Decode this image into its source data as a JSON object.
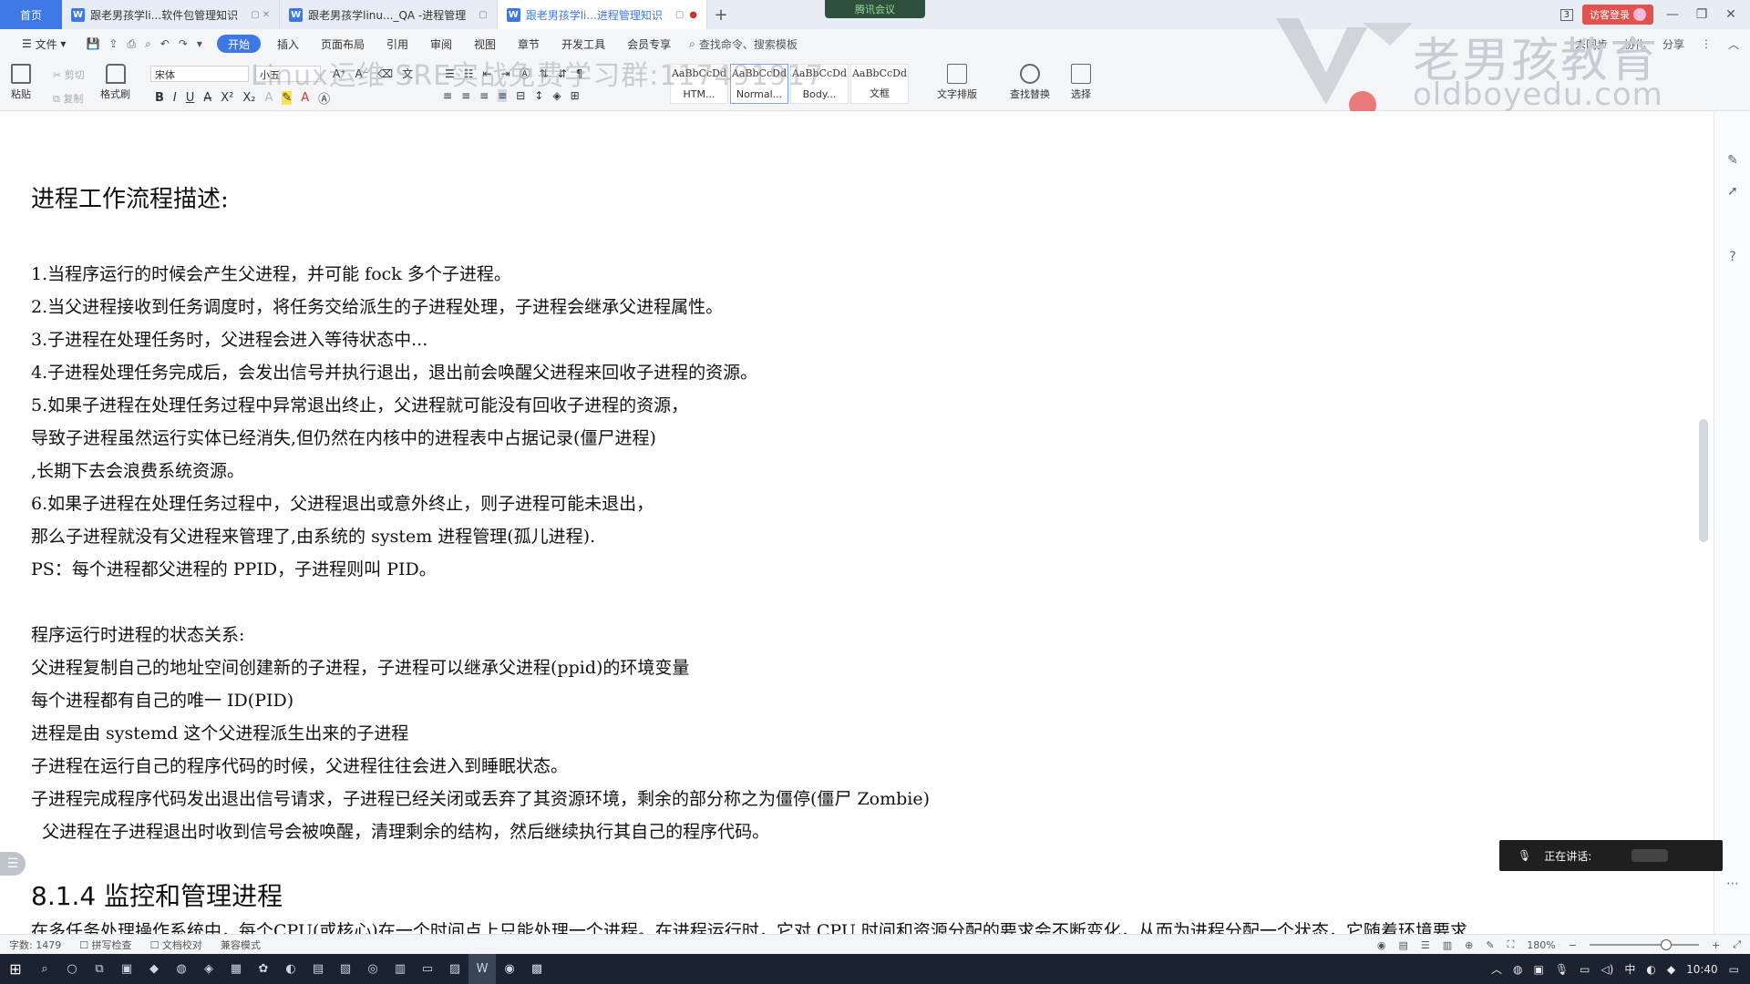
{
  "tabs": {
    "home": "首页",
    "docs": [
      {
        "title": "跟老男孩学li...软件包管理知识",
        "active": false
      },
      {
        "title": "跟老男孩学linu..._QA -进程管理",
        "active": false
      },
      {
        "title": "跟老男孩学li...进程管理知识",
        "active": true
      }
    ],
    "plus": "+",
    "meeting": "腾讯会议",
    "window_count": "3",
    "login": "访客登录"
  },
  "menu": {
    "file": "文件",
    "items": [
      "开始",
      "插入",
      "页面布局",
      "引用",
      "审阅",
      "视图",
      "章节",
      "开发工具",
      "会员专享"
    ],
    "active": "开始",
    "search": "查找命令、搜索模板",
    "right": [
      "未同步",
      "协作",
      "分享"
    ]
  },
  "ribbon": {
    "paste": "粘贴",
    "cut": "剪切",
    "copy": "复制",
    "format_painter": "格式刷",
    "font_name": "宋体",
    "font_size": "小五",
    "styles": [
      {
        "preview": "AaBbCcDd",
        "label": "HTM..."
      },
      {
        "preview": "AaBbCcDd",
        "label": "Normal..."
      },
      {
        "preview": "AaBbCcDd",
        "label": "Body..."
      },
      {
        "preview": "AaBbCcDd",
        "label": "文框"
      }
    ],
    "text_layout": "文字排版",
    "find_replace": "查找替换",
    "select": "选择"
  },
  "watermark": {
    "brand": "老男孩教育",
    "url": "oldboyedu.com",
    "qq": "Linux运维 SRE实战免费学习群:117491917"
  },
  "document": {
    "title": "进程工作流程描述:",
    "lines": [
      "1.当程序运行的时候会产生父进程，并可能 fock 多个子进程。",
      "2.当父进程接收到任务调度时，将任务交给派生的子进程处理，子进程会继承父进程属性。",
      "3.子进程在处理任务时，父进程会进入等待状态中...",
      "4.子进程处理任务完成后，会发出信号并执行退出，退出前会唤醒父进程来回收子进程的资源。",
      "5.如果子进程在处理任务过程中异常退出终止，父进程就可能没有回收子进程的资源，",
      "导致子进程虽然运行实体已经消失,但仍然在内核中的进程表中占据记录(僵尸进程)",
      ",长期下去会浪费系统资源。",
      "6.如果子进程在处理任务过程中，父进程退出或意外终止，则子进程可能未退出，",
      "那么子进程就没有父进程来管理了,由系统的 system 进程管理(孤儿进程).",
      "PS：每个进程都父进程的 PPID，子进程则叫 PID。"
    ],
    "state_title": "程序运行时进程的状态关系:",
    "state_lines": [
      "父进程复制自己的地址空间创建新的子进程，子进程可以继承父进程(ppid)的环境变量",
      "每个进程都有自己的唯一 ID(PID)",
      "进程是由 systemd 这个父进程派生出来的子进程",
      "子进程在运行自己的程序代码的时候，父进程往往会进入到睡眠状态。",
      "子进程完成程序代码发出退出信号请求，子进程已经关闭或丢弃了其资源环境，剩余的部分称之为僵停(僵尸 Zombie)",
      "  父进程在子进程退出时收到信号会被唤醒，清理剩余的结构，然后继续执行其自己的程序代码。"
    ],
    "section": "8.1.4  监控和管理进程",
    "cut_line": "在多任务处理操作系统中，每个CPU(或核心)在一个时间点上只能处理一个进程。在进程运行时，它对 CPU 时间和资源分配的要求会不断变化，从而为进程分配一个状态，它随着环境要求"
  },
  "overlay": {
    "speaking": "正在讲话:"
  },
  "status": {
    "word_count": "字数: 1479",
    "spell_check": "拼写检查",
    "doc_check": "文档校对",
    "compat": "兼容模式",
    "zoom": "180%"
  },
  "taskbar": {
    "clock": "10:40",
    "ime": "中"
  }
}
